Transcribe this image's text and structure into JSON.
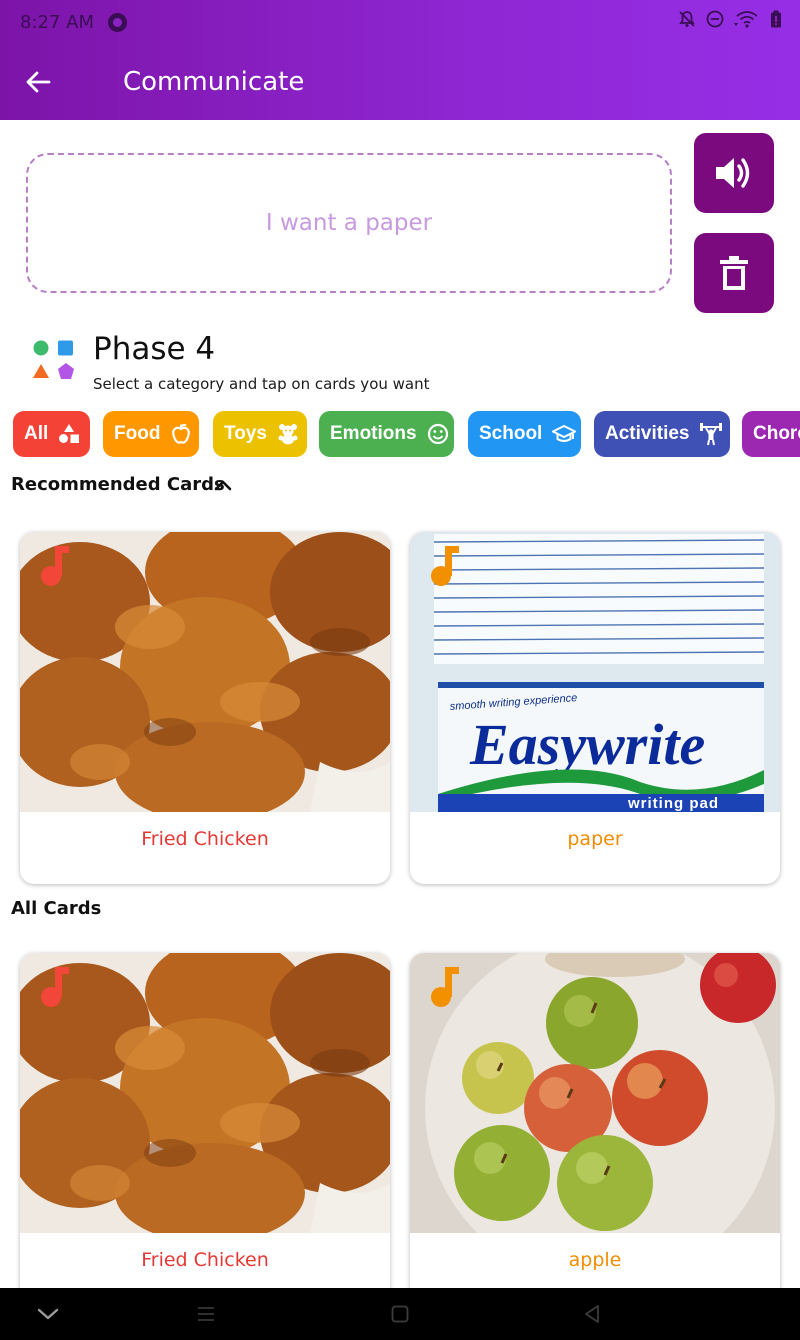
{
  "status_bar": {
    "time": "8:27 AM"
  },
  "app_bar": {
    "title": "Communicate"
  },
  "sentence": {
    "text": "I want a paper"
  },
  "phase": {
    "title": "Phase 4",
    "subtitle": "Select a category and tap on cards you want"
  },
  "categories": [
    {
      "label": "All",
      "color": "#f44336",
      "icon": "shapes-icon"
    },
    {
      "label": "Food",
      "color": "#ff9800",
      "icon": "apple-icon"
    },
    {
      "label": "Toys",
      "color": "#ebc100",
      "icon": "teddy-bear-icon"
    },
    {
      "label": "Emotions",
      "color": "#4caf50",
      "icon": "smiley-icon"
    },
    {
      "label": "School",
      "color": "#2196f3",
      "icon": "graduation-cap-icon"
    },
    {
      "label": "Activities",
      "color": "#3f51b5",
      "icon": "weightlifter-icon"
    },
    {
      "label": "Chore",
      "color": "#9c27b0",
      "icon": "broom-icon"
    }
  ],
  "recommended": {
    "title": "Recommended Cards",
    "cards": [
      {
        "label": "Fried Chicken",
        "color": "#e53935",
        "image": "fried-chicken-photo"
      },
      {
        "label": "paper",
        "color": "#f28c00",
        "image": "writing-pad-photo",
        "brand": "Easywrite",
        "tagline": "smooth writing experience",
        "product": "writing pad"
      }
    ]
  },
  "all_cards": {
    "title": "All Cards",
    "cards": [
      {
        "label": "Fried Chicken",
        "color": "#e53935",
        "image": "fried-chicken-photo"
      },
      {
        "label": "apple",
        "color": "#f28c00",
        "image": "apples-photo"
      }
    ]
  },
  "colors": {
    "primary": "#7b0a7e",
    "app_bar_start": "#7d14a8",
    "app_bar_end": "#962ee6",
    "dashed_border": "#b97fc6",
    "sentence_text": "#c79ae0"
  }
}
